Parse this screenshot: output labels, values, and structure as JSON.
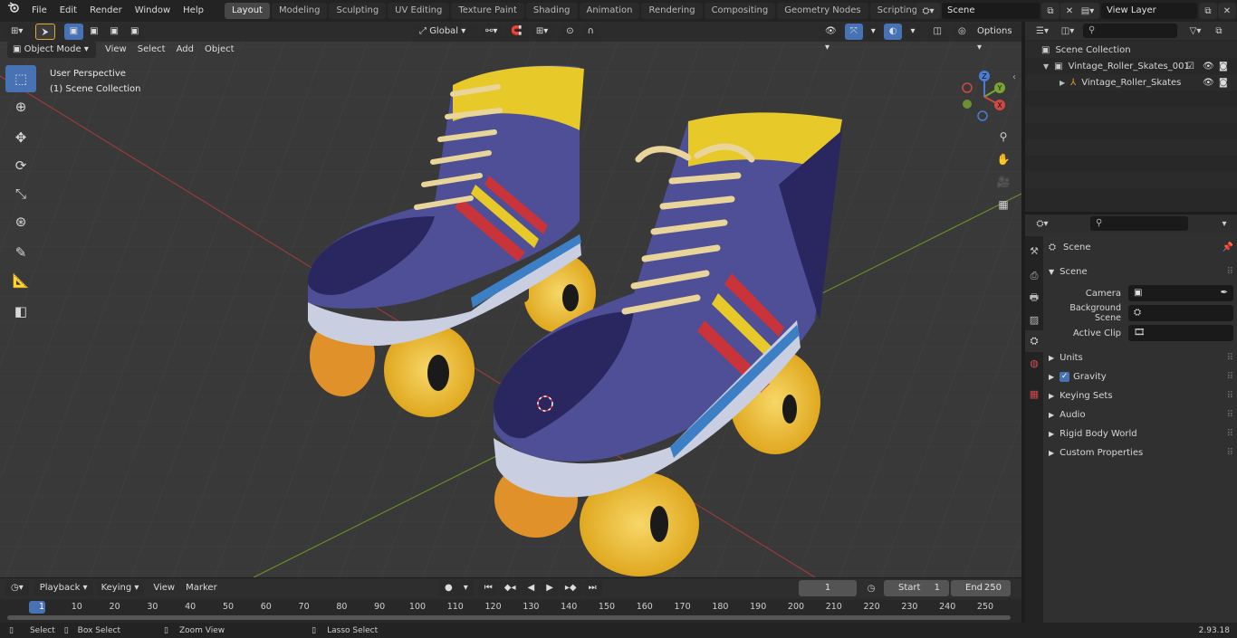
{
  "topbar": {
    "menus": [
      "File",
      "Edit",
      "Render",
      "Window",
      "Help"
    ],
    "workspaces": [
      "Layout",
      "Modeling",
      "Sculpting",
      "UV Editing",
      "Texture Paint",
      "Shading",
      "Animation",
      "Rendering",
      "Compositing",
      "Geometry Nodes",
      "Scripting"
    ],
    "active_workspace": "Layout",
    "scene_name": "Scene",
    "view_layer_name": "View Layer"
  },
  "viewport": {
    "mode": "Object Mode",
    "menus": [
      "View",
      "Select",
      "Add",
      "Object"
    ],
    "transform_orientation": "Global",
    "options_label": "Options",
    "info_line1": "User Perspective",
    "info_line2": "(1) Scene Collection",
    "gizmo": {
      "z": "Z",
      "y": "Y",
      "x": "X"
    }
  },
  "outliner": {
    "root": "Scene Collection",
    "items": [
      {
        "name": "Vintage_Roller_Skates_001"
      },
      {
        "name": "Vintage_Roller_Skates"
      }
    ]
  },
  "properties": {
    "context_label": "Scene",
    "section_scene": "Scene",
    "fields": [
      {
        "label": "Camera"
      },
      {
        "label": "Background Scene"
      },
      {
        "label": "Active Clip"
      }
    ],
    "panels": [
      "Units",
      "Gravity",
      "Keying Sets",
      "Audio",
      "Rigid Body World",
      "Custom Properties"
    ]
  },
  "timeline": {
    "menus": [
      "Playback",
      "Keying",
      "View",
      "Marker"
    ],
    "current_frame": "1",
    "start_label": "Start",
    "start_value": "1",
    "end_label": "End",
    "end_value": "250",
    "ruler": [
      "1",
      "10",
      "20",
      "30",
      "40",
      "50",
      "60",
      "70",
      "80",
      "90",
      "100",
      "110",
      "120",
      "130",
      "140",
      "150",
      "160",
      "170",
      "180",
      "190",
      "200",
      "210",
      "220",
      "230",
      "240",
      "250"
    ]
  },
  "statusbar": {
    "items": [
      "Select",
      "Box Select",
      "Zoom View",
      "Lasso Select"
    ],
    "version": "2.93.18"
  },
  "colors": {
    "accent": "#4772b3",
    "boot_purple": "#4e4f96",
    "boot_dark": "#2a2660",
    "boot_yellow": "#e8c92a",
    "stripe_red": "#c8343a",
    "wheel_yellow": "#f2c23a",
    "wheel_orange": "#e0912a"
  }
}
